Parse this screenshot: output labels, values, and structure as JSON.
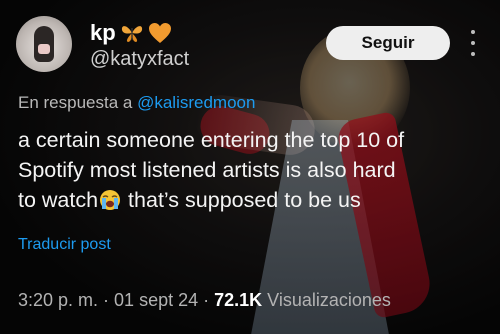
{
  "author": {
    "display_name": "kp",
    "emoji_1": "butterfly-icon",
    "emoji_2": "orange-heart-icon",
    "handle": "@katyxfact"
  },
  "actions": {
    "follow_label": "Seguir",
    "more_icon": "more-vertical-icon"
  },
  "reply": {
    "prefix": "En respuesta a",
    "mention": "@kalisredmoon"
  },
  "tweet": {
    "line_1": "a certain someone entering the top 10 of",
    "line_2": "Spotify most listened artists is also hard",
    "line_3a": "to watch",
    "line_3_emoji": "loudly-crying-face-icon",
    "line_3b": " that’s supposed to be us"
  },
  "translate_label": "Traducir post",
  "meta": {
    "time": "3:20 p. m.",
    "sep_1": " · ",
    "date": "01 sept 24",
    "sep_2": " · ",
    "views_count": "72.1K",
    "views_label": " Visualizaciones"
  },
  "colors": {
    "link": "#1d9bf0",
    "follow_bg": "#eeeeee",
    "heart": "#f29b2f"
  }
}
